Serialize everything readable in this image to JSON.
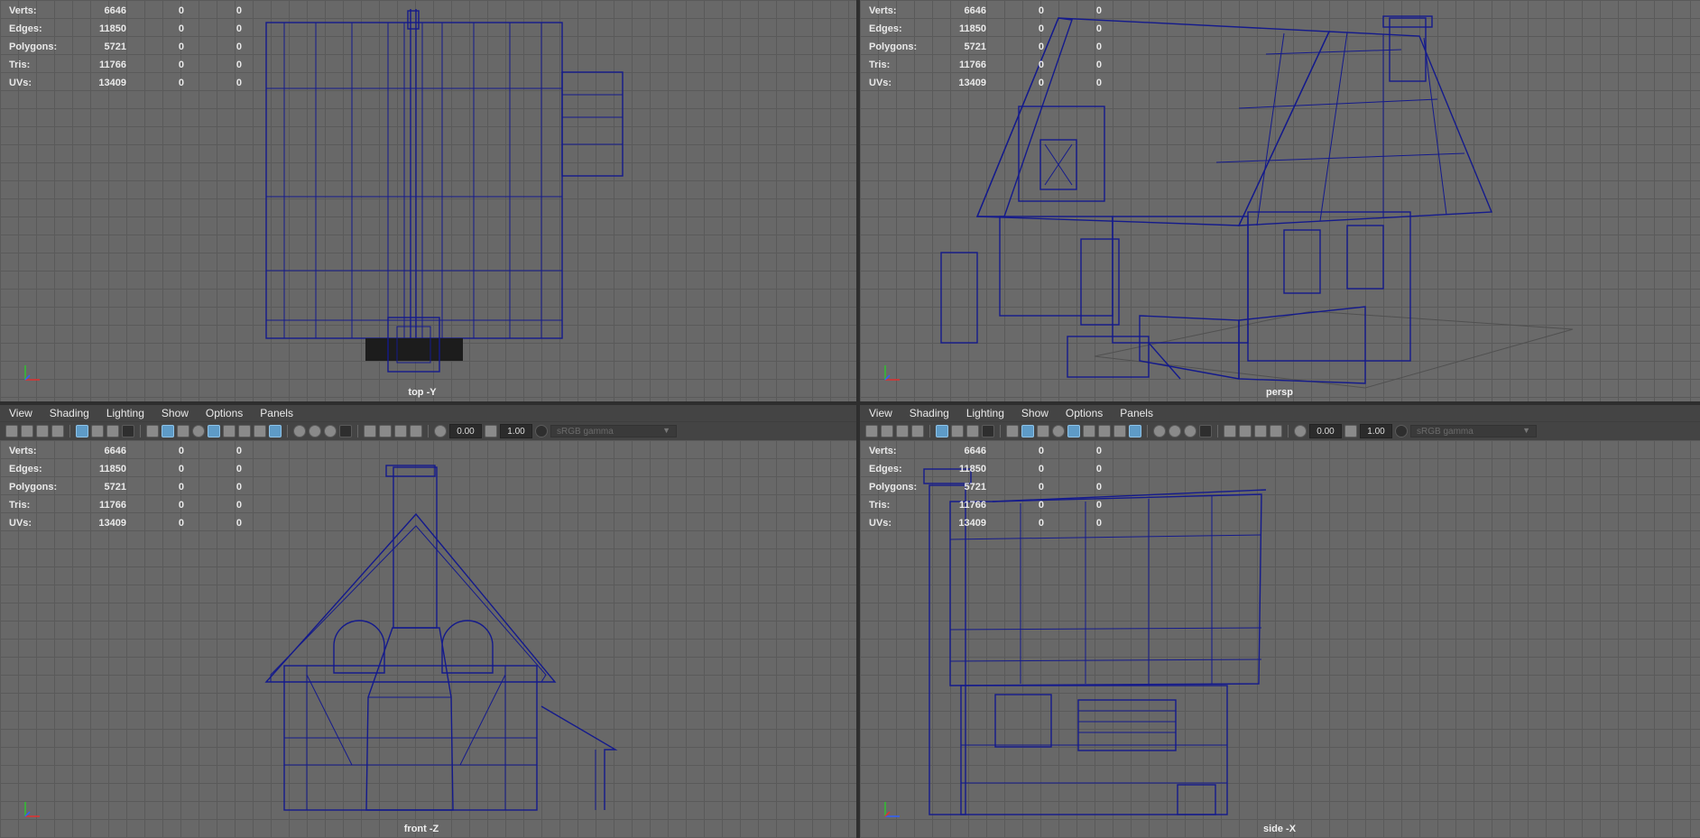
{
  "hud": {
    "rows": [
      {
        "label": "Verts:",
        "value": "6646",
        "a": "0",
        "b": "0"
      },
      {
        "label": "Edges:",
        "value": "11850",
        "a": "0",
        "b": "0"
      },
      {
        "label": "Polygons:",
        "value": "5721",
        "a": "0",
        "b": "0"
      },
      {
        "label": "Tris:",
        "value": "11766",
        "a": "0",
        "b": "0"
      },
      {
        "label": "UVs:",
        "value": "13409",
        "a": "0",
        "b": "0"
      }
    ]
  },
  "panels": {
    "top_left": {
      "camera": "top -Y"
    },
    "top_right": {
      "camera": "persp"
    },
    "bottom_left": {
      "camera": "front -Z"
    },
    "bottom_right": {
      "camera": "side -X"
    }
  },
  "menu": [
    "View",
    "Shading",
    "Lighting",
    "Show",
    "Options",
    "Panels"
  ],
  "toolbar": {
    "near_clip": "0.00",
    "far_clip": "1.00",
    "color_space": "sRGB gamma",
    "icons": [
      "camera-icon",
      "camera-lock-icon",
      "bookmark-icon",
      "image-plane-icon",
      "grid-toggle-icon",
      "film-gate-icon",
      "resolution-gate-icon",
      "gate-mask-icon",
      "wireframe-icon",
      "smooth-shade-icon",
      "default-material-icon",
      "xray-icon",
      "textured-icon",
      "lights-icon",
      "shadows-icon",
      "ambient-occlusion-icon",
      "motion-blur-icon",
      "antialias-icon",
      "depth-of-field-icon",
      "isolate-select-icon",
      "xray-joints-icon",
      "xray-active-icon",
      "backface-icon",
      "exposure-icon",
      "gamma-icon"
    ]
  },
  "colors": {
    "viewport_bg": "#686868",
    "grid_line": "#5a5a5a",
    "wireframe": "#141a8c",
    "active_icon": "#5e9bc7"
  }
}
